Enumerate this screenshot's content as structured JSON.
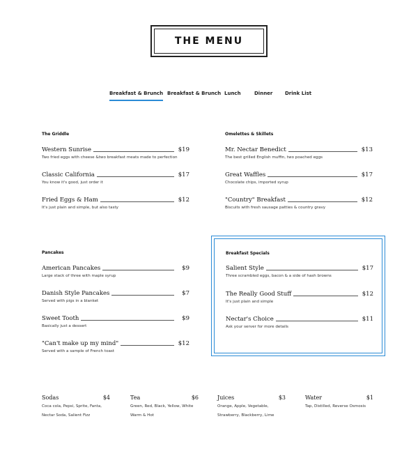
{
  "title": "THE MENU",
  "tabs": [
    {
      "label": "Breakfast & Brunch",
      "active": true
    },
    {
      "label": "Breakfast & Brunch",
      "active": false
    },
    {
      "label": "Lunch",
      "active": false
    },
    {
      "label": "Dinner",
      "active": false
    },
    {
      "label": "Drink List",
      "active": false
    }
  ],
  "sections": {
    "griddle": {
      "heading": "The Griddle",
      "items": [
        {
          "name": "Western Sunrise",
          "price": "$19",
          "desc": "Two fried eggs with cheese &two breakfast meats made to perfection"
        },
        {
          "name": "Classic California",
          "price": "$17",
          "desc": "You know it's good, just order it"
        },
        {
          "name": "Fried Eggs & Ham",
          "price": "$12",
          "desc": "It's just plain and simple, but also tasty"
        }
      ]
    },
    "omelettes": {
      "heading": "Omelettes & Skillets",
      "items": [
        {
          "name": "Mr. Nectar Benedict",
          "price": "$13",
          "desc": "The best grilled English muffin, two poached eggs"
        },
        {
          "name": "Great Waffles",
          "price": "$17",
          "desc": "Chocolate chips, imported syrup"
        },
        {
          "name": "\"Country\" Breakfast",
          "price": "$12",
          "desc": "Biscuits with fresh sausage patties & country gravy"
        }
      ]
    },
    "pancakes": {
      "heading": "Pancakes",
      "items": [
        {
          "name": "American Pancakes",
          "price": "$9",
          "desc": "Large stack of three with maple syrup"
        },
        {
          "name": "Danish Style Pancakes",
          "price": "$7",
          "desc": "Served with pigs in a blanket"
        },
        {
          "name": "Sweet Tooth",
          "price": "$9",
          "desc": "Basically just a dessert"
        },
        {
          "name": "\"Can't make up my mind\"",
          "price": "$12",
          "desc": "Served with a sample of French toast"
        }
      ]
    },
    "specials": {
      "heading": "Breakfast Specials",
      "items": [
        {
          "name": "Salient Style",
          "price": "$17",
          "desc": "Three scrambled eggs, bacon & a side of hash browns"
        },
        {
          "name": "The Really Good Stuff",
          "price": "$12",
          "desc": "It's just plain and simple"
        },
        {
          "name": "Nectar's Choice",
          "price": "$11",
          "desc": "Ask your server for more details"
        }
      ]
    }
  },
  "drinks": [
    {
      "name": "Sodas",
      "price": "$4",
      "line1": "Coca cola, Pepsi, Sprite, Fanta,",
      "line2": "Nectar Soda, Salient Fizz"
    },
    {
      "name": "Tea",
      "price": "$6",
      "line1": "Green, Red, Black, Yellow, White",
      "line2": "Warm & Hot"
    },
    {
      "name": "Juices",
      "price": "$3",
      "line1": "Orange, Apple, Vegetable,",
      "line2": "Strawberry, Blackberry, Lime"
    },
    {
      "name": "Water",
      "price": "$1",
      "line1": "Tap, Distilled, Reverse Osmosis",
      "line2": ""
    }
  ],
  "colors": {
    "accent": "#2a8bd6",
    "text": "#111111",
    "background": "#ffffff"
  }
}
